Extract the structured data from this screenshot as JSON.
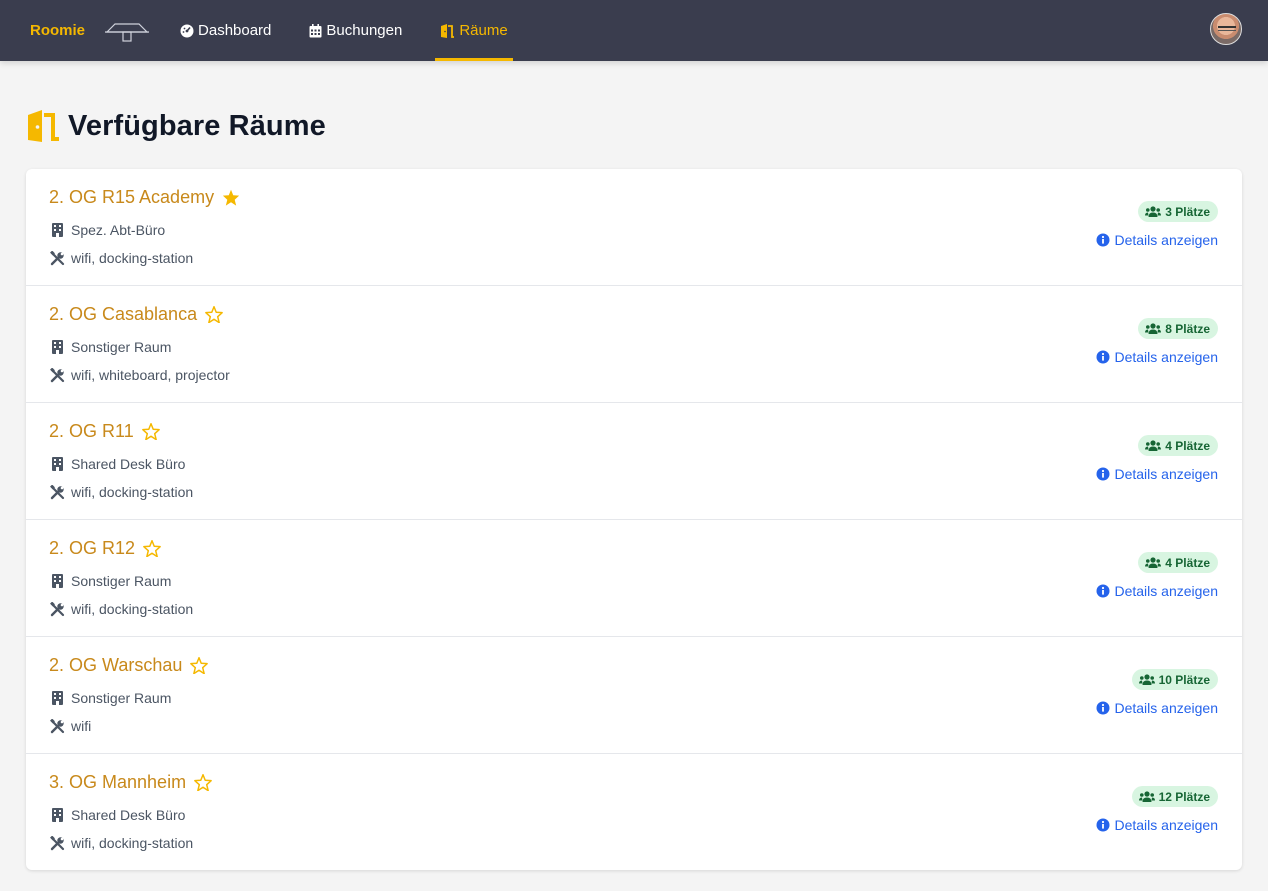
{
  "nav": {
    "brand": "Roomie",
    "items": [
      {
        "label": "Dashboard",
        "icon": "dashboard-icon",
        "active": false
      },
      {
        "label": "Buchungen",
        "icon": "calendar-icon",
        "active": false
      },
      {
        "label": "Räume",
        "icon": "door-icon",
        "active": true
      }
    ],
    "accent_color": "#f5b800",
    "bg_color": "#3a3d4e"
  },
  "page": {
    "title": "Verfügbare Räume"
  },
  "rooms": [
    {
      "name": "2. OG R15 Academy",
      "favorite": true,
      "type": "Spez. Abt-Büro",
      "equipment": "wifi, docking-station",
      "seats": "3 Plätze",
      "details": "Details anzeigen"
    },
    {
      "name": "2. OG Casablanca",
      "favorite": false,
      "type": "Sonstiger Raum",
      "equipment": "wifi, whiteboard, projector",
      "seats": "8 Plätze",
      "details": "Details anzeigen"
    },
    {
      "name": "2. OG R11",
      "favorite": false,
      "type": "Shared Desk Büro",
      "equipment": "wifi, docking-station",
      "seats": "4 Plätze",
      "details": "Details anzeigen"
    },
    {
      "name": "2. OG R12",
      "favorite": false,
      "type": "Sonstiger Raum",
      "equipment": "wifi, docking-station",
      "seats": "4 Plätze",
      "details": "Details anzeigen"
    },
    {
      "name": "2. OG Warschau",
      "favorite": false,
      "type": "Sonstiger Raum",
      "equipment": "wifi",
      "seats": "10 Plätze",
      "details": "Details anzeigen"
    },
    {
      "name": "3. OG Mannheim",
      "favorite": false,
      "type": "Shared Desk Büro",
      "equipment": "wifi, docking-station",
      "seats": "12 Plätze",
      "details": "Details anzeigen"
    }
  ]
}
